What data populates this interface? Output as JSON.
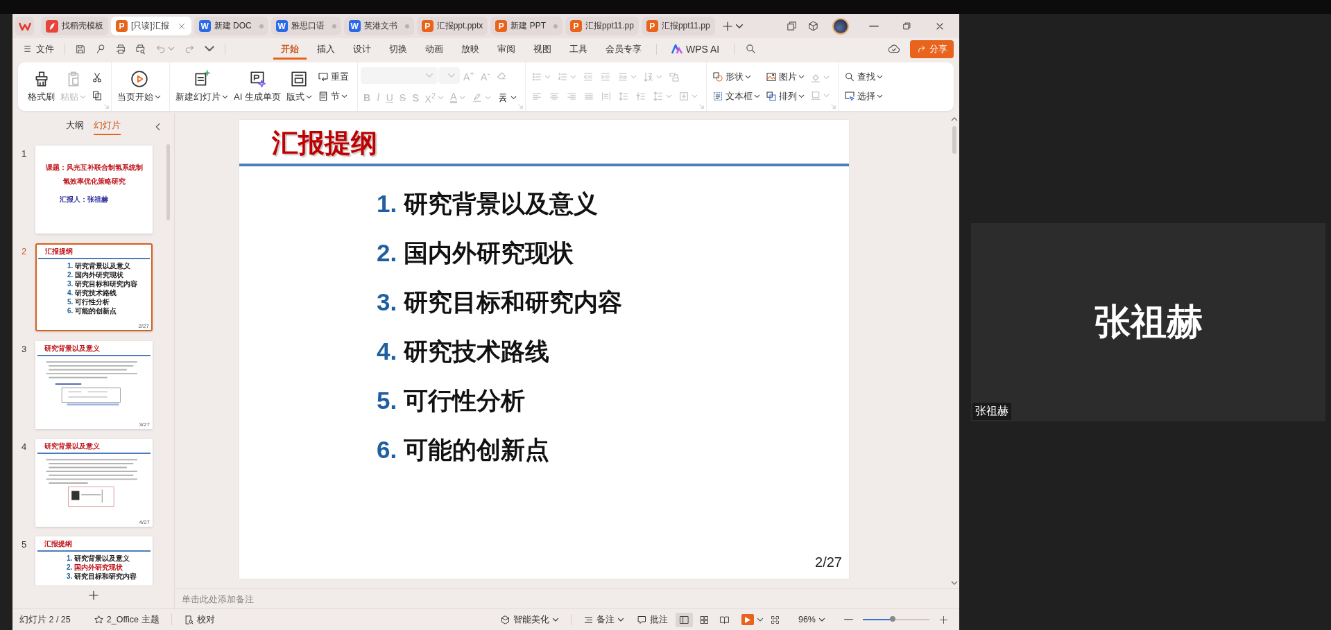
{
  "tabs": [
    {
      "label": "找稻壳模板",
      "kind": "template",
      "selected": false,
      "modified": false
    },
    {
      "label": "[只读]汇报",
      "kind": "presentation",
      "badge": "P",
      "selected": true,
      "modified": false
    },
    {
      "label": "新建 DOC",
      "kind": "writer",
      "badge": "W",
      "selected": false,
      "modified": true
    },
    {
      "label": "雅思口语",
      "kind": "writer",
      "badge": "W",
      "selected": false,
      "modified": true
    },
    {
      "label": "英港文书",
      "kind": "writer",
      "badge": "W",
      "selected": false,
      "modified": true
    },
    {
      "label": "汇报ppt.pptx",
      "kind": "presentation",
      "badge": "P",
      "selected": false,
      "modified": false
    },
    {
      "label": "新建 PPT",
      "kind": "presentation",
      "badge": "P",
      "selected": false,
      "modified": true
    },
    {
      "label": "汇报ppt11.pp",
      "kind": "presentation",
      "badge": "P",
      "selected": false,
      "modified": false
    },
    {
      "label": "汇报ppt11.pp",
      "kind": "presentation",
      "badge": "P",
      "selected": false,
      "modified": false
    }
  ],
  "menu": {
    "file": "文件",
    "tabs": [
      {
        "label": "开始",
        "selected": true
      },
      {
        "label": "插入",
        "selected": false
      },
      {
        "label": "设计",
        "selected": false
      },
      {
        "label": "切换",
        "selected": false
      },
      {
        "label": "动画",
        "selected": false
      },
      {
        "label": "放映",
        "selected": false
      },
      {
        "label": "审阅",
        "selected": false
      },
      {
        "label": "视图",
        "selected": false
      },
      {
        "label": "工具",
        "selected": false
      },
      {
        "label": "会员专享",
        "selected": false
      }
    ],
    "ai": "WPS AI",
    "share": "分享"
  },
  "ribbon": [
    {
      "kind": "columns",
      "launcher": true,
      "lines": [
        [
          {
            "kind": "button",
            "label": "格式刷",
            "disabled": false,
            "dropdown": false
          }
        ],
        [
          {
            "kind": "button",
            "label": "粘贴",
            "disabled": true,
            "dropdown": true
          }
        ],
        [
          {
            "kind": "button",
            "disabled": false,
            "dropdown": false
          },
          {
            "kind": "button",
            "disabled": false,
            "dropdown": false
          }
        ]
      ]
    },
    {
      "kind": "columns",
      "launcher": false,
      "lines": [
        [
          {
            "kind": "button",
            "label": "当页开始",
            "disabled": false,
            "dropdown": true
          }
        ]
      ]
    },
    {
      "kind": "columns",
      "launcher": false,
      "lines": [
        [
          {
            "kind": "button",
            "label": "新建幻灯片",
            "disabled": false,
            "dropdown": true
          }
        ],
        [
          {
            "kind": "button",
            "label": "AI 生成单页",
            "disabled": false,
            "dropdown": false
          }
        ],
        [
          {
            "kind": "button",
            "label": "版式",
            "disabled": false,
            "dropdown": true
          }
        ],
        [
          {
            "kind": "button",
            "label": "重置",
            "disabled": false,
            "dropdown": false
          },
          {
            "kind": "button",
            "label": "节",
            "disabled": false,
            "dropdown": true
          }
        ]
      ]
    },
    {
      "kind": "rows",
      "launcher": true,
      "lines": [
        [
          {
            "kind": "field",
            "disabled": true
          },
          {
            "kind": "field",
            "disabled": true
          },
          {
            "kind": "glyph",
            "label": "A$^{+}$",
            "disabled": true,
            "dropdown": false
          },
          {
            "kind": "glyph",
            "label": "A$^{-}$",
            "disabled": true,
            "dropdown": false
          },
          {
            "kind": "button",
            "disabled": true,
            "dropdown": false
          }
        ],
        [
          {
            "kind": "glyph",
            "label": "B",
            "disabled": true,
            "dropdown": false
          },
          {
            "kind": "glyph",
            "label": "I",
            "disabled": true,
            "dropdown": false
          },
          {
            "kind": "glyph",
            "label": "U",
            "disabled": true,
            "dropdown": false
          },
          {
            "kind": "glyph",
            "label": "S",
            "disabled": true,
            "dropdown": false
          },
          {
            "kind": "glyph",
            "label": "S",
            "disabled": true,
            "dropdown": false
          },
          {
            "kind": "glyph",
            "label": "X$^{2}$",
            "disabled": true,
            "dropdown": true
          },
          {
            "kind": "glyph",
            "label": "A",
            "disabled": true,
            "dropdown": true
          },
          {
            "kind": "button",
            "disabled": true,
            "dropdown": true
          },
          {
            "kind": "button",
            "disabled": false,
            "dropdown": true
          }
        ]
      ]
    },
    {
      "kind": "rows",
      "launcher": true,
      "lines": [
        [
          {
            "kind": "button",
            "disabled": true,
            "dropdown": true
          },
          {
            "kind": "button",
            "disabled": true,
            "dropdown": true
          },
          {
            "kind": "button",
            "disabled": true,
            "dropdown": false
          },
          {
            "kind": "button",
            "disabled": true,
            "dropdown": false
          },
          {
            "kind": "button",
            "disabled": true,
            "dropdown": true
          },
          {
            "kind": "button",
            "disabled": true,
            "dropdown": true
          },
          {
            "kind": "button",
            "disabled": true,
            "dropdown": false
          }
        ],
        [
          {
            "kind": "button",
            "disabled": true,
            "dropdown": false
          },
          {
            "kind": "button",
            "disabled": true,
            "dropdown": false
          },
          {
            "kind": "button",
            "disabled": true,
            "dropdown": false
          },
          {
            "kind": "button",
            "disabled": true,
            "dropdown": false
          },
          {
            "kind": "button",
            "disabled": true,
            "dropdown": false
          },
          {
            "kind": "button",
            "disabled": true,
            "dropdown": false
          },
          {
            "kind": "button",
            "disabled": true,
            "dropdown": false
          },
          {
            "kind": "button",
            "disabled": true,
            "dropdown": true
          },
          {
            "kind": "button",
            "disabled": true,
            "dropdown": true
          }
        ]
      ]
    },
    {
      "kind": "columns",
      "launcher": true,
      "lines": [
        [
          {
            "kind": "button",
            "label": "形状",
            "disabled": false,
            "dropdown": true
          },
          {
            "kind": "button",
            "label": "文本框",
            "disabled": false,
            "dropdown": true
          }
        ],
        [
          {
            "kind": "button",
            "label": "图片",
            "disabled": false,
            "dropdown": true
          },
          {
            "kind": "button",
            "label": "排列",
            "disabled": false,
            "dropdown": true
          }
        ],
        [
          {
            "kind": "button",
            "disabled": true,
            "dropdown": true
          },
          {
            "kind": "button",
            "disabled": true,
            "dropdown": true
          }
        ]
      ]
    },
    {
      "kind": "columns",
      "launcher": false,
      "lines": [
        [
          {
            "kind": "button",
            "label": "查找",
            "disabled": false,
            "dropdown": true
          },
          {
            "kind": "button",
            "label": "选择",
            "disabled": false,
            "dropdown": true
          }
        ]
      ]
    }
  ],
  "panel_tabs": [
    {
      "label": "大纲",
      "selected": false
    },
    {
      "label": "幻灯片",
      "selected": true
    }
  ],
  "thumbnails": [
    {
      "number": "1",
      "kind": "cover",
      "selected": false,
      "title_lines": [
        "课题：风光互补联合制氢系统制",
        "氢效率优化策略研究"
      ],
      "reporter": "汇报人：张祖赫"
    },
    {
      "number": "2",
      "kind": "outline",
      "selected": true,
      "title": "汇报提纲",
      "items": [
        {
          "number": "1.",
          "text": "研究背景以及意义",
          "highlight": false
        },
        {
          "number": "2.",
          "text": "国内外研究现状",
          "highlight": false
        },
        {
          "number": "3.",
          "text": "研究目标和研究内容",
          "highlight": false
        },
        {
          "number": "4.",
          "text": "研究技术路线",
          "highlight": false
        },
        {
          "number": "5.",
          "text": "可行性分析",
          "highlight": false
        },
        {
          "number": "6.",
          "text": "可能的创新点",
          "highlight": false
        }
      ],
      "page": "2/27"
    },
    {
      "number": "3",
      "kind": "content",
      "selected": false,
      "title": "研究背景以及意义",
      "page": "3/27"
    },
    {
      "number": "4",
      "kind": "content",
      "selected": false,
      "title": "研究背景以及意义",
      "page": "4/27"
    },
    {
      "number": "5",
      "kind": "outline",
      "selected": false,
      "title": "汇报提纲",
      "items": [
        {
          "number": "1.",
          "text": "研究背景以及意义",
          "highlight": false
        },
        {
          "number": "2.",
          "text": "国内外研究现状",
          "highlight": true
        },
        {
          "number": "3.",
          "text": "研究目标和研究内容",
          "highlight": false
        }
      ]
    }
  ],
  "slide": {
    "title": "汇报提纲",
    "items": [
      {
        "number": "1.",
        "text": "研究背景以及意义"
      },
      {
        "number": "2.",
        "text": "国内外研究现状"
      },
      {
        "number": "3.",
        "text": "研究目标和研究内容"
      },
      {
        "number": "4.",
        "text": "研究技术路线"
      },
      {
        "number": "5.",
        "text": "可行性分析"
      },
      {
        "number": "6.",
        "text": "可能的创新点"
      }
    ],
    "page": "2/27"
  },
  "notes": {
    "placeholder": "单击此处添加备注"
  },
  "status_bar": {
    "slide_info": "幻灯片 2 / 25",
    "theme": "2_Office 主题",
    "proofing": "校对",
    "beautify": "智能美化",
    "notes": "备注",
    "comments": "批注",
    "views": [
      {
        "kind": "normal",
        "selected": true
      },
      {
        "kind": "sorter",
        "selected": false
      },
      {
        "kind": "reading",
        "selected": false
      }
    ],
    "zoom": "96%",
    "zoom_slider": {
      "level": 0.45
    }
  },
  "video": {
    "name": "张祖赫",
    "label": "张祖赫"
  }
}
